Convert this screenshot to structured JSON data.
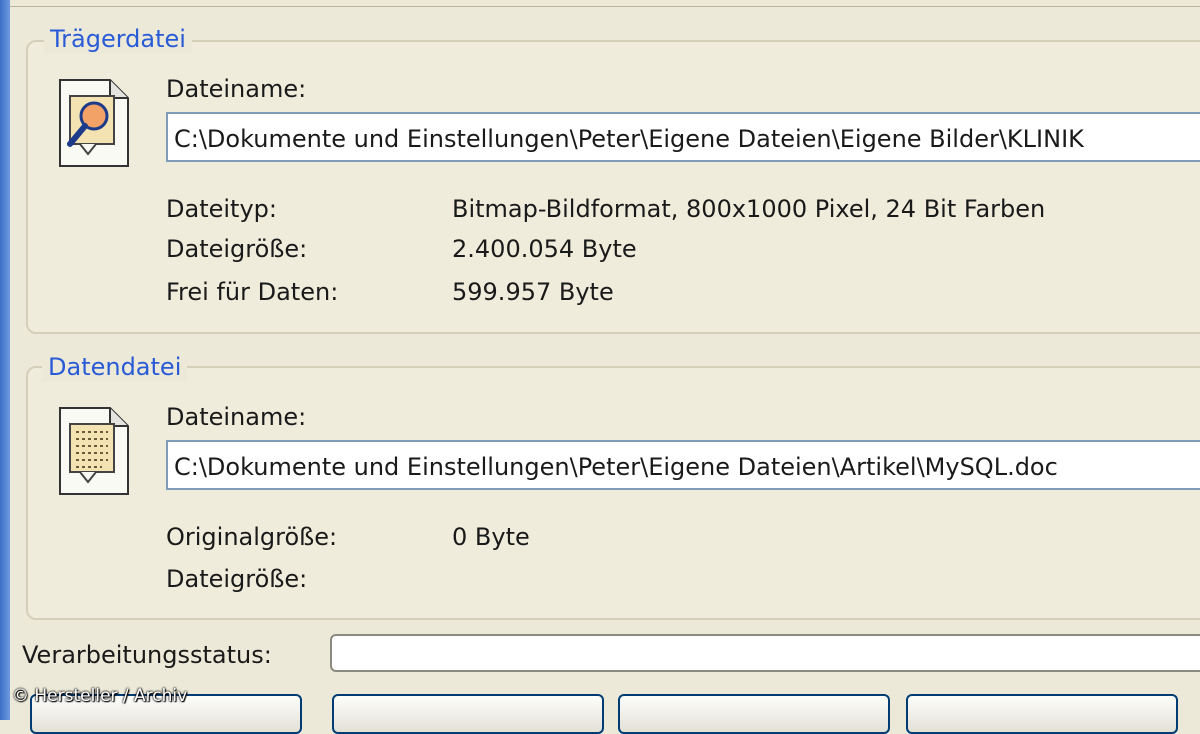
{
  "carrier_file": {
    "title": "Trägerdatei",
    "filename_label": "Dateiname:",
    "filename_value": "C:\\Dokumente und Einstellungen\\Peter\\Eigene Dateien\\Eigene Bilder\\KLINIK",
    "icon": "magnifier-document-icon",
    "info": [
      {
        "label": "Dateityp:",
        "value": "Bitmap-Bildformat, 800x1000 Pixel, 24 Bit Farben"
      },
      {
        "label": "Dateigröße:",
        "value": "2.400.054 Byte"
      },
      {
        "label": "Frei für Daten:",
        "value": "599.957 Byte"
      }
    ]
  },
  "data_file": {
    "title": "Datendatei",
    "filename_label": "Dateiname:",
    "filename_value": "C:\\Dokumente und Einstellungen\\Peter\\Eigene Dateien\\Artikel\\MySQL.doc",
    "icon": "text-document-icon",
    "info": [
      {
        "label": "Originalgröße:",
        "value": "0 Byte"
      },
      {
        "label": "Dateigröße:",
        "value": ""
      }
    ]
  },
  "status": {
    "label": "Verarbeitungsstatus:"
  },
  "credit": "© Hersteller / Archiv",
  "colors": {
    "window_bg": "#ece9d8",
    "group_title": "#2a5bd7",
    "input_border": "#7f9db9",
    "button_border": "#003c74"
  }
}
